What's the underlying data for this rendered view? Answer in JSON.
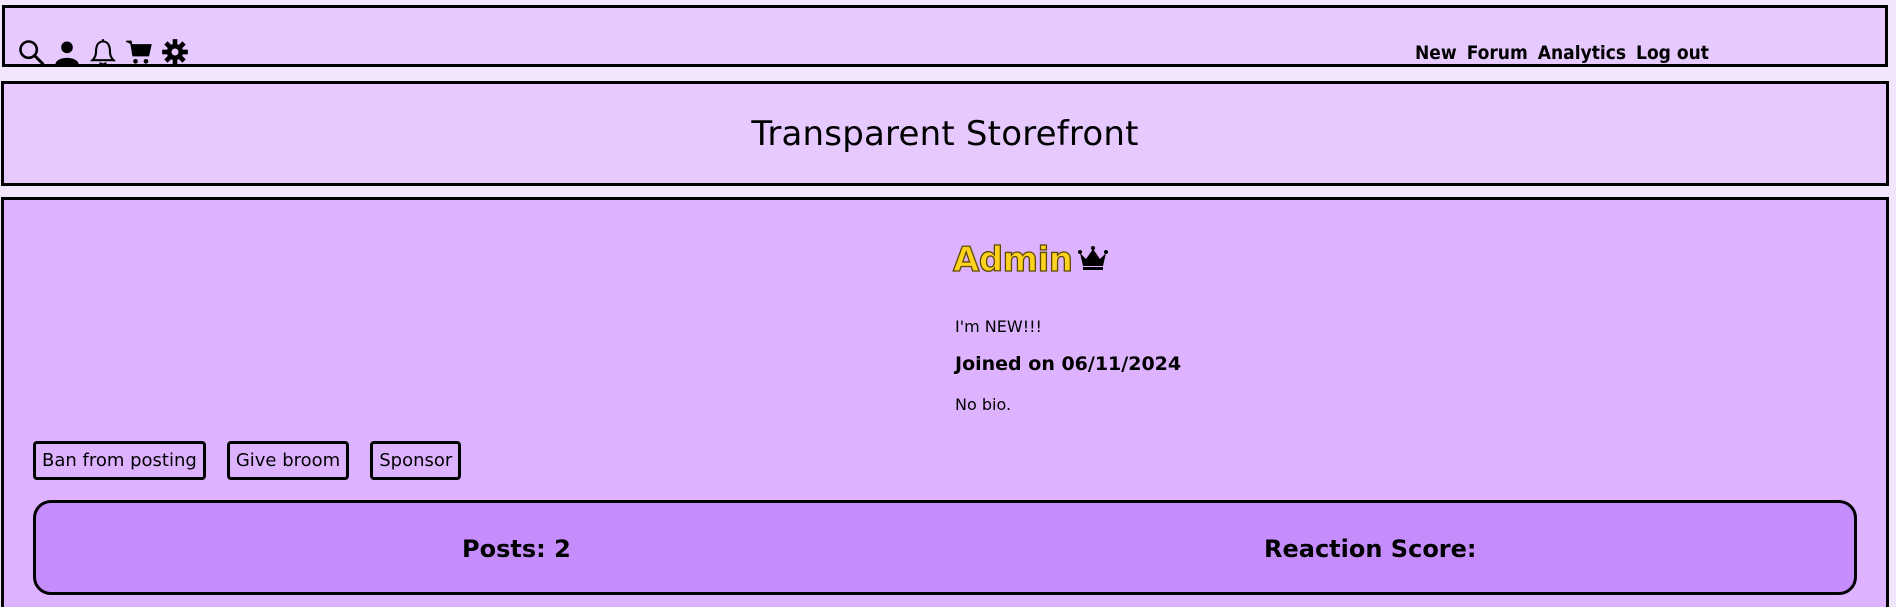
{
  "header": {
    "icons": [
      "search-icon",
      "user-icon",
      "bell-icon",
      "cart-icon",
      "gear-icon"
    ],
    "nav": [
      "New",
      "Forum",
      "Analytics",
      "Log out"
    ]
  },
  "banner": {
    "title": "Transparent Storefront"
  },
  "profile": {
    "username": "Admin",
    "username_color": "#ffd21f",
    "badge_icon": "crown-icon",
    "status": "I'm NEW!!!",
    "joined": "Joined on 06/11/2024",
    "bio": "No bio.",
    "actions": [
      "Ban from posting",
      "Give broom",
      "Sponsor"
    ],
    "stats": {
      "posts_label": "Posts: 2",
      "reaction_label": "Reaction Score:"
    }
  },
  "colors": {
    "header_bg": "#e6c9ff",
    "profile_bg": "#ddb3ff",
    "stats_bg": "#c58dfb"
  }
}
